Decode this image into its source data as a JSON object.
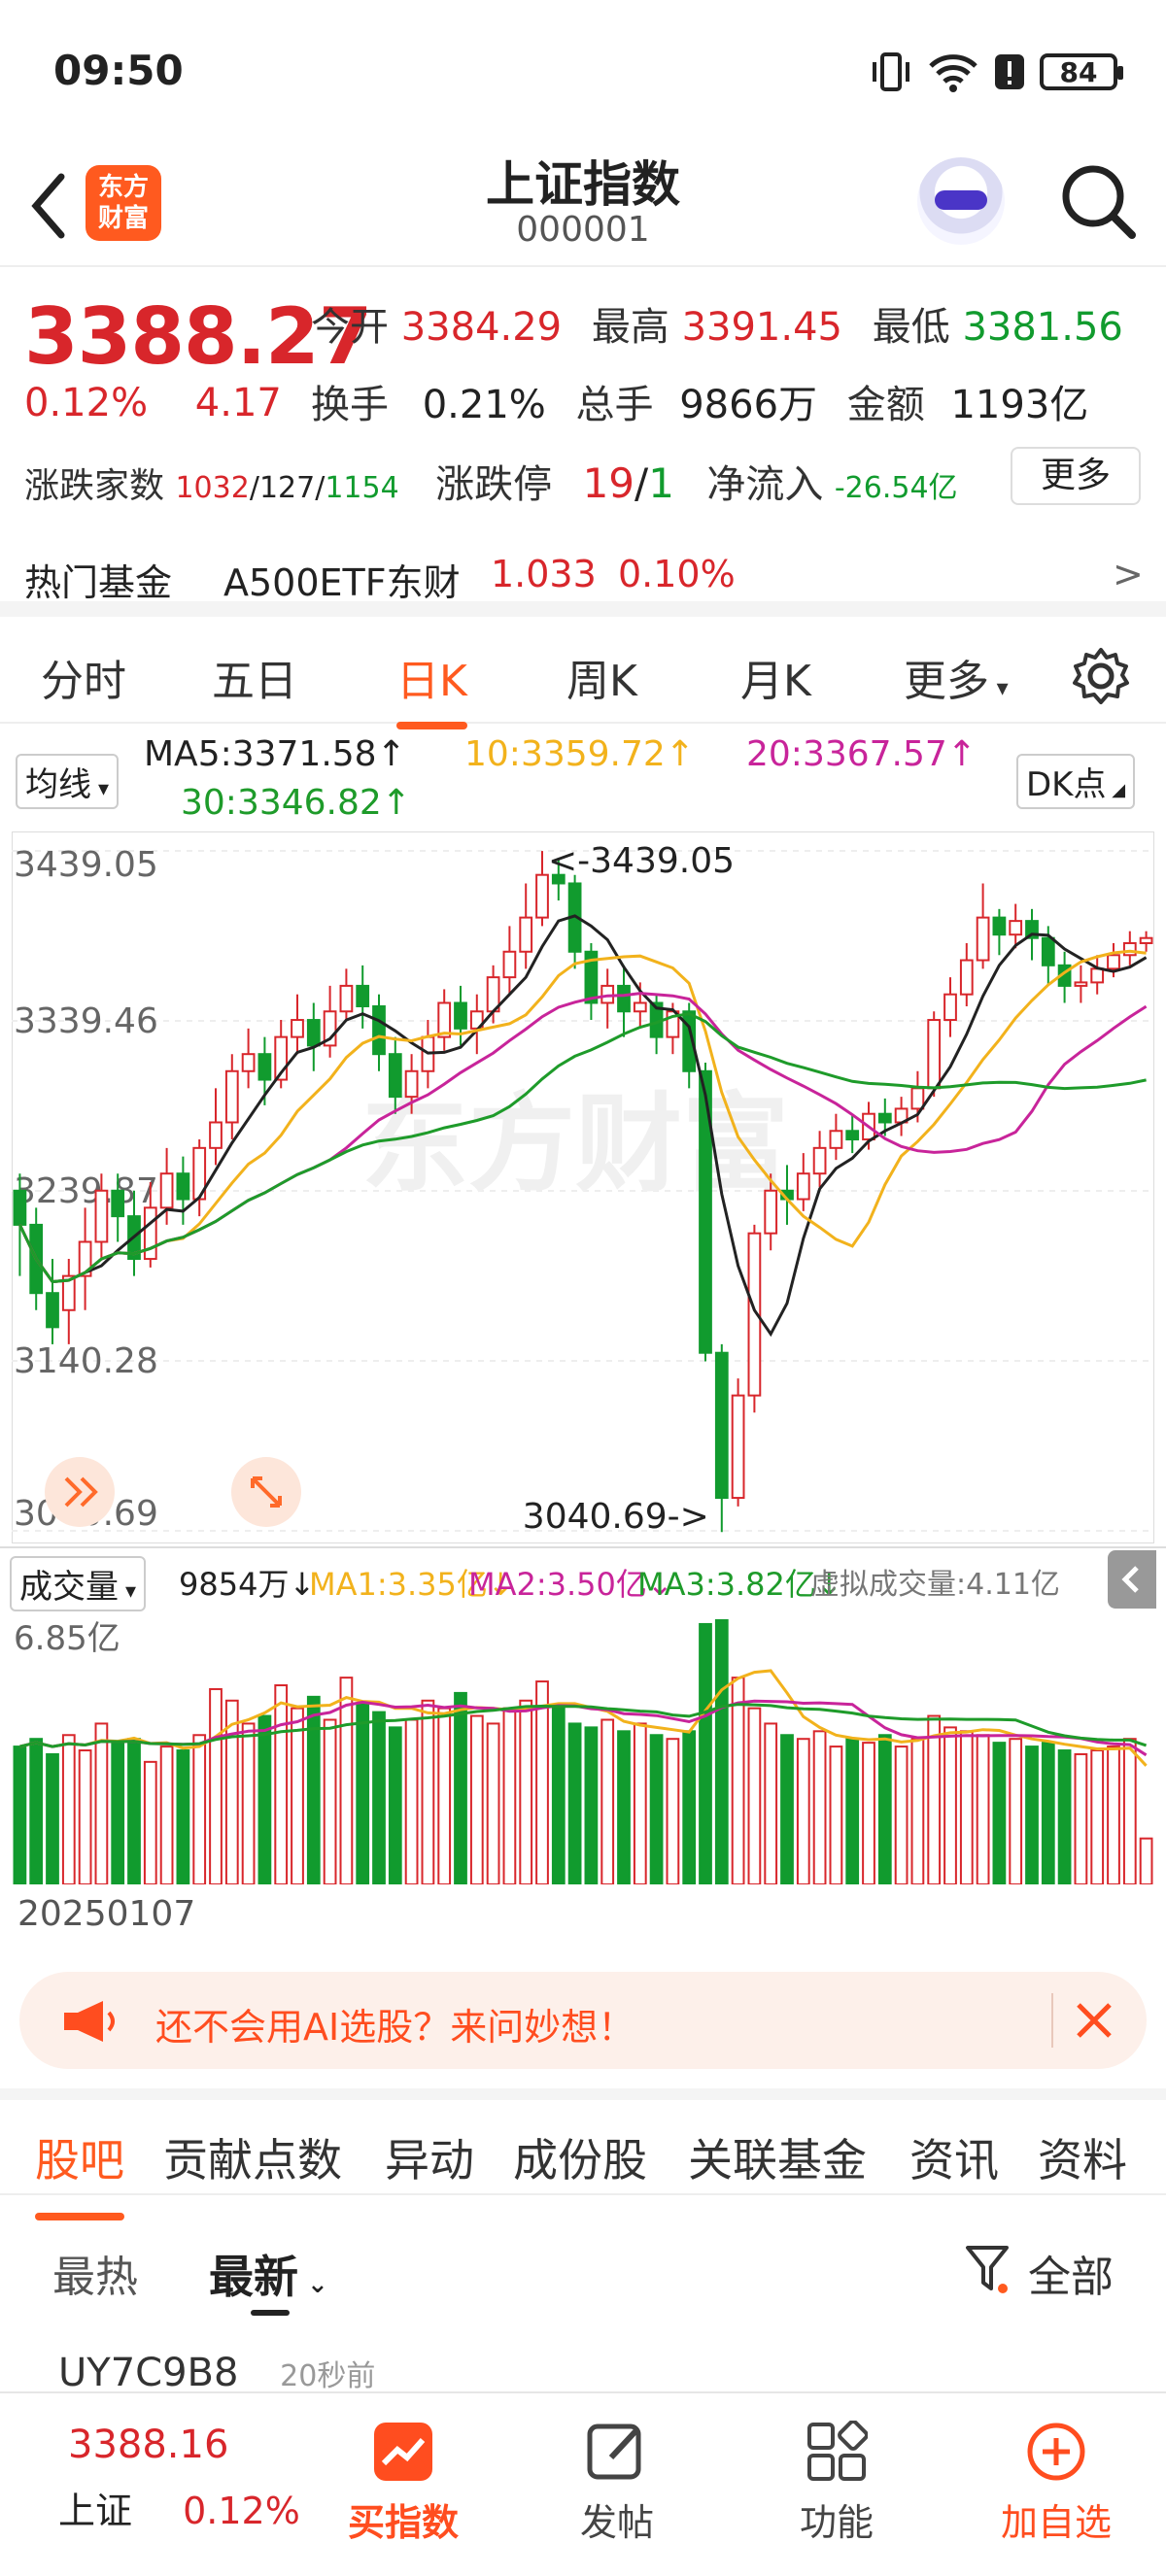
{
  "status": {
    "time": "09:50",
    "battery": "84"
  },
  "header": {
    "logo_line1": "东方",
    "logo_line2": "财富",
    "title": "上证指数",
    "code": "000001"
  },
  "quote": {
    "price": "3388.27",
    "change_pct": "0.12%",
    "change_val": "4.17",
    "open_label": "今开",
    "open": "3384.29",
    "high_label": "最高",
    "high": "3391.45",
    "low_label": "最低",
    "low": "3381.56",
    "turnover_label": "换手",
    "turnover": "0.21%",
    "volume_label": "总手",
    "volume": "9866万",
    "amount_label": "金额",
    "amount": "1193亿",
    "updown_label": "涨跌家数",
    "up": "1032",
    "flat": "127",
    "down": "1154",
    "limit_label": "涨跌停",
    "limit_up": "19",
    "limit_down": "1",
    "netflow_label": "净流入",
    "netflow": "-26.54亿",
    "more": "更多"
  },
  "hotfund": {
    "label": "热门基金",
    "name": "A500ETF东财",
    "price": "1.033",
    "pct": "0.10%",
    "arrow": ">"
  },
  "periods": [
    "分时",
    "五日",
    "日K",
    "周K",
    "月K",
    "更多"
  ],
  "ma": {
    "selector": "均线",
    "ma5": "MA5:3371.58↑",
    "ma10": "10:3359.72↑",
    "ma20": "20:3367.57↑",
    "ma30": "30:3346.82↑",
    "dk": "DK点",
    "colors": {
      "ma5": "#222222",
      "ma10": "#f2b21c",
      "ma20": "#c8249a",
      "ma30": "#1e9b2a"
    }
  },
  "chart_data": {
    "type": "candlestick",
    "y_labels": [
      "3439.05",
      "3339.46",
      "3239.87",
      "3140.28",
      "3040.69"
    ],
    "ylim": [
      3040.69,
      3439.05
    ],
    "high_annotation": "3439.05",
    "low_annotation": "3040.69",
    "candles": [
      [
        3240,
        3220,
        3250,
        3190
      ],
      [
        3220,
        3180,
        3230,
        3170
      ],
      [
        3180,
        3160,
        3200,
        3150
      ],
      [
        3170,
        3190,
        3200,
        3150
      ],
      [
        3190,
        3210,
        3230,
        3170
      ],
      [
        3210,
        3240,
        3250,
        3200
      ],
      [
        3240,
        3225,
        3250,
        3210
      ],
      [
        3225,
        3200,
        3240,
        3190
      ],
      [
        3200,
        3230,
        3245,
        3195
      ],
      [
        3230,
        3250,
        3265,
        3220
      ],
      [
        3250,
        3235,
        3260,
        3220
      ],
      [
        3235,
        3265,
        3270,
        3225
      ],
      [
        3265,
        3280,
        3300,
        3255
      ],
      [
        3280,
        3310,
        3320,
        3270
      ],
      [
        3310,
        3320,
        3335,
        3300
      ],
      [
        3320,
        3305,
        3330,
        3290
      ],
      [
        3305,
        3330,
        3340,
        3300
      ],
      [
        3330,
        3340,
        3355,
        3320
      ],
      [
        3340,
        3325,
        3350,
        3310
      ],
      [
        3325,
        3345,
        3360,
        3318
      ],
      [
        3345,
        3360,
        3370,
        3340
      ],
      [
        3360,
        3348,
        3372,
        3335
      ],
      [
        3348,
        3320,
        3355,
        3310
      ],
      [
        3320,
        3295,
        3330,
        3285
      ],
      [
        3295,
        3310,
        3320,
        3285
      ],
      [
        3310,
        3330,
        3340,
        3300
      ],
      [
        3330,
        3350,
        3358,
        3322
      ],
      [
        3350,
        3335,
        3360,
        3325
      ],
      [
        3335,
        3345,
        3355,
        3320
      ],
      [
        3345,
        3365,
        3372,
        3338
      ],
      [
        3365,
        3380,
        3395,
        3355
      ],
      [
        3380,
        3400,
        3420,
        3370
      ],
      [
        3400,
        3425,
        3439,
        3395
      ],
      [
        3425,
        3420,
        3435,
        3410
      ],
      [
        3420,
        3380,
        3425,
        3370
      ],
      [
        3380,
        3350,
        3385,
        3340
      ],
      [
        3350,
        3360,
        3370,
        3335
      ],
      [
        3360,
        3345,
        3372,
        3330
      ],
      [
        3345,
        3350,
        3362,
        3335
      ],
      [
        3350,
        3330,
        3355,
        3320
      ],
      [
        3330,
        3345,
        3350,
        3320
      ],
      [
        3345,
        3310,
        3350,
        3300
      ],
      [
        3310,
        3145,
        3315,
        3140
      ],
      [
        3145,
        3060,
        3150,
        3040
      ],
      [
        3060,
        3120,
        3130,
        3055
      ],
      [
        3120,
        3215,
        3220,
        3110
      ],
      [
        3215,
        3240,
        3250,
        3205
      ],
      [
        3240,
        3235,
        3255,
        3220
      ],
      [
        3235,
        3250,
        3262,
        3228
      ],
      [
        3250,
        3265,
        3275,
        3242
      ],
      [
        3265,
        3275,
        3285,
        3258
      ],
      [
        3275,
        3270,
        3284,
        3262
      ],
      [
        3270,
        3285,
        3292,
        3264
      ],
      [
        3285,
        3280,
        3294,
        3272
      ],
      [
        3280,
        3288,
        3295,
        3272
      ],
      [
        3288,
        3300,
        3310,
        3280
      ],
      [
        3300,
        3340,
        3345,
        3295
      ],
      [
        3340,
        3355,
        3365,
        3330
      ],
      [
        3355,
        3375,
        3385,
        3348
      ],
      [
        3375,
        3400,
        3420,
        3370
      ],
      [
        3400,
        3390,
        3405,
        3378
      ],
      [
        3390,
        3398,
        3408,
        3382
      ],
      [
        3398,
        3388,
        3405,
        3375
      ],
      [
        3388,
        3372,
        3395,
        3360
      ],
      [
        3372,
        3360,
        3380,
        3350
      ],
      [
        3360,
        3362,
        3372,
        3350
      ],
      [
        3362,
        3370,
        3378,
        3355
      ],
      [
        3370,
        3378,
        3385,
        3365
      ],
      [
        3378,
        3385,
        3392,
        3372
      ],
      [
        3385,
        3388,
        3392,
        3380
      ]
    ]
  },
  "volume": {
    "selector": "成交量",
    "vol": "9854万↓",
    "ma1": "MA1:3.35亿↓",
    "ma2": "MA2:3.50亿↓",
    "ma3": "MA3:3.82亿↓",
    "virtual": "虚拟成交量:4.11亿",
    "max_label": "6.85亿",
    "values": [
      3.6,
      3.8,
      3.4,
      3.9,
      3.5,
      4.2,
      3.7,
      3.8,
      3.2,
      3.6,
      3.5,
      3.9,
      5.1,
      4.8,
      4.2,
      4.4,
      5.2,
      4.6,
      4.9,
      4.3,
      5.4,
      4.7,
      4.5,
      4.1,
      4.3,
      4.8,
      4.6,
      5.0,
      4.4,
      4.2,
      4.6,
      4.8,
      5.3,
      4.7,
      4.2,
      4.1,
      4.3,
      4.0,
      4.2,
      3.9,
      3.8,
      4.0,
      6.8,
      6.9,
      5.4,
      4.6,
      4.2,
      3.9,
      3.8,
      4.0,
      3.6,
      3.8,
      3.7,
      3.9,
      3.6,
      3.8,
      4.4,
      4.1,
      4.0,
      3.9,
      3.7,
      3.8,
      3.6,
      3.7,
      3.5,
      3.4,
      3.5,
      3.6,
      3.8,
      1.2
    ]
  },
  "date": "20250107",
  "ai": {
    "text": "还不会用AI选股？来问妙想！"
  },
  "tabs2": [
    "股吧",
    "贡献点数",
    "异动",
    "成份股",
    "关联基金",
    "资讯",
    "资料"
  ],
  "filters": {
    "hot": "最热",
    "new": "最新",
    "all": "全部"
  },
  "post": {
    "user": "UY7C9B8",
    "time": "20秒前"
  },
  "bottom": {
    "index_price": "3388.16",
    "index_name": "上证",
    "index_pct": "0.12%",
    "buy": "买指数",
    "post": "发帖",
    "func": "功能",
    "add": "加自选"
  }
}
